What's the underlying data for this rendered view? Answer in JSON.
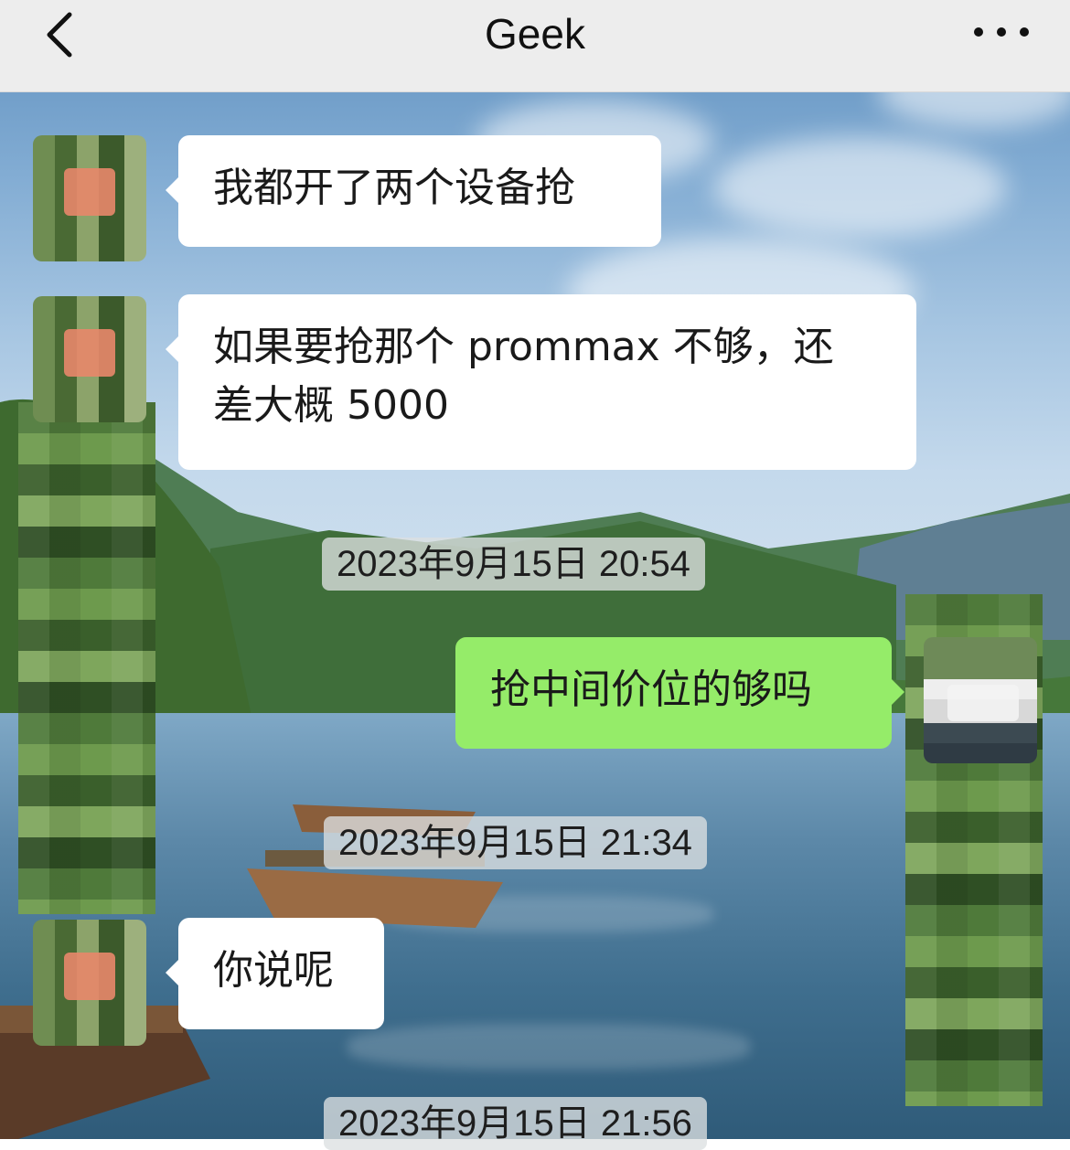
{
  "header": {
    "title": "Geek",
    "back_icon": "chevron-left-icon",
    "more_icon": "more-horizontal-icon"
  },
  "messages": [
    {
      "sender": "other",
      "text": "我都开了两个设备抢"
    },
    {
      "sender": "other",
      "text_line1": "如果要抢那个 prommax 不够，还",
      "text_line2": "差大概 5000"
    },
    {
      "sender": "self",
      "text": "抢中间价位的够吗"
    },
    {
      "sender": "other",
      "text": "你说呢"
    }
  ],
  "timestamps": [
    "2023年9月15日 20:54",
    "2023年9月15日 21:34",
    "2023年9月15日 21:56"
  ],
  "colors": {
    "header_bg": "#ededed",
    "incoming_bubble": "#ffffff",
    "outgoing_bubble": "#95ec69"
  }
}
